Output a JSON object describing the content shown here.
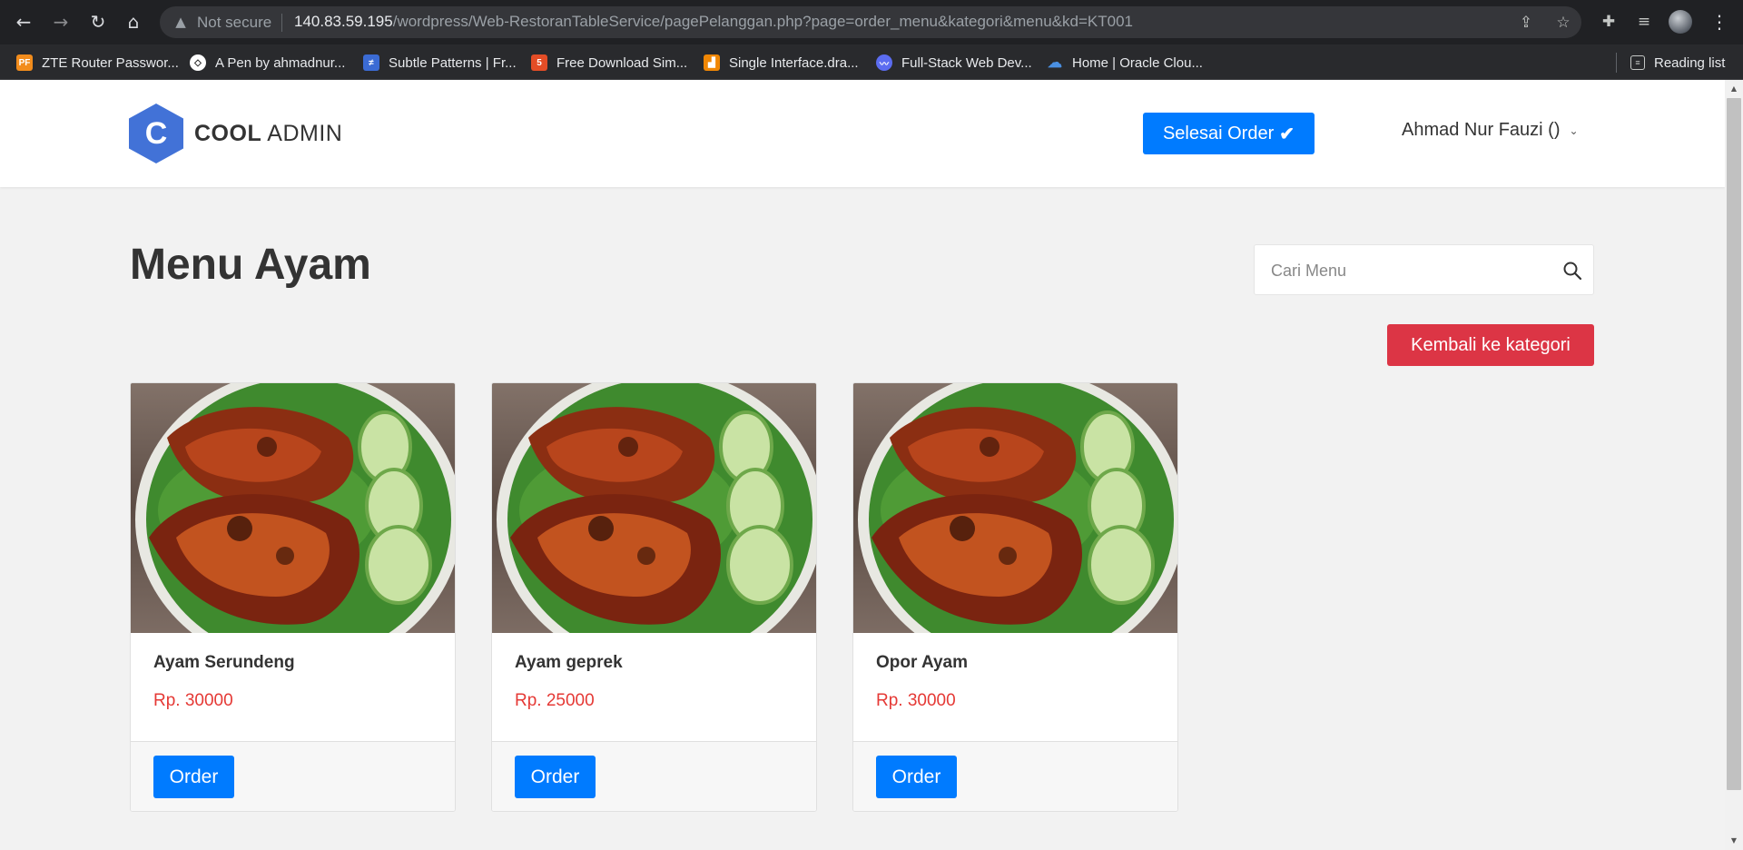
{
  "browser": {
    "security_label": "Not secure",
    "url_host": "140.83.59.195",
    "url_path": "/wordpress/Web-RestoranTableService/pagePelanggan.php?page=order_menu&kategori&menu&kd=KT001",
    "bookmarks": [
      {
        "label": "ZTE Router Passwor...",
        "icon": "pf-favicon",
        "color": "#f28c1c",
        "glyph": "PF"
      },
      {
        "label": "A Pen by ahmadnur...",
        "icon": "codepen-favicon",
        "color": "#ffffff",
        "glyph": "◇"
      },
      {
        "label": "Subtle Patterns | Fr...",
        "icon": "subtle-patterns-favicon",
        "color": "#3b6bd4",
        "glyph": "≠"
      },
      {
        "label": "Free Download Sim...",
        "icon": "html5-favicon",
        "color": "#e44d26",
        "glyph": "5"
      },
      {
        "label": "Single Interface.dra...",
        "icon": "drawio-favicon",
        "color": "#f08705",
        "glyph": "▟"
      },
      {
        "label": "Full-Stack Web Dev...",
        "icon": "fullstack-favicon",
        "color": "#5b6cf0",
        "glyph": "〰"
      },
      {
        "label": "Home | Oracle Clou...",
        "icon": "cloud-favicon",
        "color": "#4a90e2",
        "glyph": "☁"
      }
    ],
    "reading_list_label": "Reading list"
  },
  "header": {
    "logo_bold": "COOL",
    "logo_light": " ADMIN",
    "logo_letter": "C",
    "finish_order_label": "Selesai Order",
    "user_name": "Ahmad Nur Fauzi ()"
  },
  "main": {
    "title": "Menu Ayam",
    "search_placeholder": "Cari Menu",
    "back_button_label": "Kembali ke kategori",
    "order_label": "Order",
    "items": [
      {
        "name": "Ayam Serundeng",
        "price": "Rp. 30000"
      },
      {
        "name": "Ayam geprek",
        "price": "Rp. 25000"
      },
      {
        "name": "Opor Ayam",
        "price": "Rp. 30000"
      }
    ]
  },
  "colors": {
    "primary": "#007bff",
    "danger": "#dc3545",
    "price": "#e53935",
    "logo": "#4272d7"
  }
}
